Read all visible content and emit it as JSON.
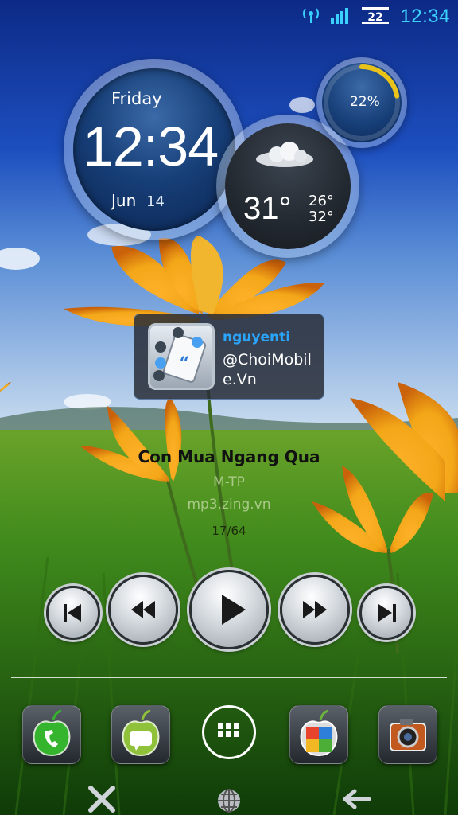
{
  "status_bar": {
    "time": "12:34",
    "icons": [
      "wifi-icon",
      "signal-icon",
      "sim-icon"
    ]
  },
  "clock_widget": {
    "day": "Friday",
    "time": "12:34",
    "month": "Jun",
    "date": "14"
  },
  "battery_widget": {
    "percent_label": "22%",
    "level": 0.22,
    "accent": "#e9c21a"
  },
  "weather_widget": {
    "condition_icon": "cloud-icon",
    "temperature": "31°",
    "low": "26°",
    "high": "32°"
  },
  "social_widget": {
    "username": "nguyenti",
    "text_line1": "@ChoiMobil",
    "text_line2": "e.Vn",
    "app_icon": "social-app-icon"
  },
  "music_player": {
    "song_title": "Con Mua Ngang Qua",
    "artist": "M-TP",
    "source": "mp3.zing.vn",
    "track": "17/64",
    "controls": [
      "skip-previous-icon",
      "rewind-icon",
      "play-icon",
      "fast-forward-icon",
      "skip-next-icon"
    ]
  },
  "dock": {
    "items": [
      "phone-icon",
      "messages-icon",
      "apps-grid-icon",
      "gallery-icon",
      "camera-icon"
    ]
  },
  "nav_bar": {
    "items": [
      "close-icon",
      "globe-icon",
      "back-arrow-icon"
    ]
  },
  "colors": {
    "status_accent": "#3ad1ff",
    "social_username": "#2aa6ff"
  }
}
